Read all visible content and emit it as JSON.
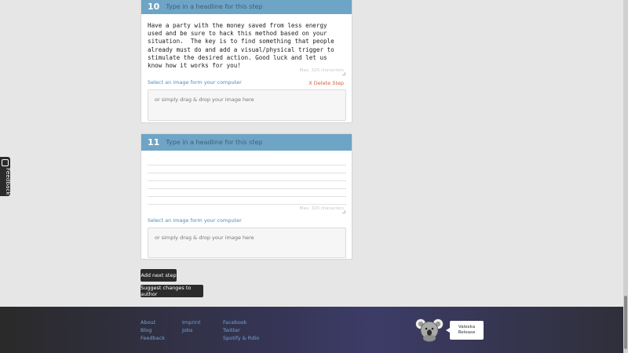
{
  "feedback_tab": {
    "label": "Feedback",
    "icon": "chat-icon"
  },
  "steps": [
    {
      "number": "10",
      "headline_placeholder": "Type in a headline for this step",
      "text": "Have a party with the money saved from less energy\nused and be sure to hack this method based on your\nsituation.  The key is to find something that people\nalready must do and add a visual/physical trigger to\nstimulate the desired action. Good luck and let us\nknow how it works for you!",
      "max_chars": "Max. 320 characters",
      "image_link": "Select an image form your computer",
      "delete_label": "X Delete Step",
      "drop_text": "or simply drag & drop your image here"
    },
    {
      "number": "11",
      "headline_placeholder": "Type in a headline for this step",
      "text": "",
      "max_chars": "Max. 320 characters",
      "image_link": "Select an image form your computer",
      "drop_text": "or simply drag & drop your image here"
    }
  ],
  "buttons": {
    "add_next_step": "Add next step",
    "suggest_changes": "Suggest changes to author"
  },
  "footer": {
    "col1": [
      "About",
      "Blog",
      "Feedback"
    ],
    "col2": [
      "Imprint",
      "Jobs"
    ],
    "col3": [
      "Facebook",
      "Twitter",
      "Spotify & Rdio"
    ],
    "mascot_icon": "koala-icon",
    "speech_line1": "Valeska",
    "speech_line2": "Release"
  },
  "colors": {
    "step_header": "#6ea4c6",
    "link": "#6fa3cf",
    "delete": "#d35f3c",
    "button": "#2b2b2b"
  }
}
